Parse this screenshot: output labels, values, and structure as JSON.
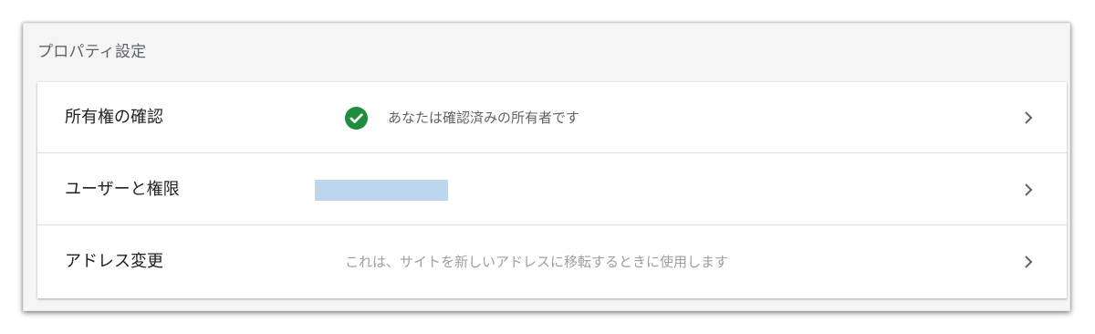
{
  "section": {
    "title": "プロパティ設定"
  },
  "rows": [
    {
      "label": "所有権の確認",
      "value": "あなたは確認済みの所有者です",
      "status_icon": "check-circle-icon",
      "status_color": "#1e8e3e",
      "action_icon": "chevron-right-icon"
    },
    {
      "label": "ユーザーと権限",
      "value": "",
      "value_redacted": true,
      "redaction_color": "#bcd6ee",
      "action_icon": "chevron-right-icon"
    },
    {
      "label": "アドレス変更",
      "value": "これは、サイトを新しいアドレスに移転するときに使用します",
      "action_icon": "chevron-right-icon"
    }
  ]
}
